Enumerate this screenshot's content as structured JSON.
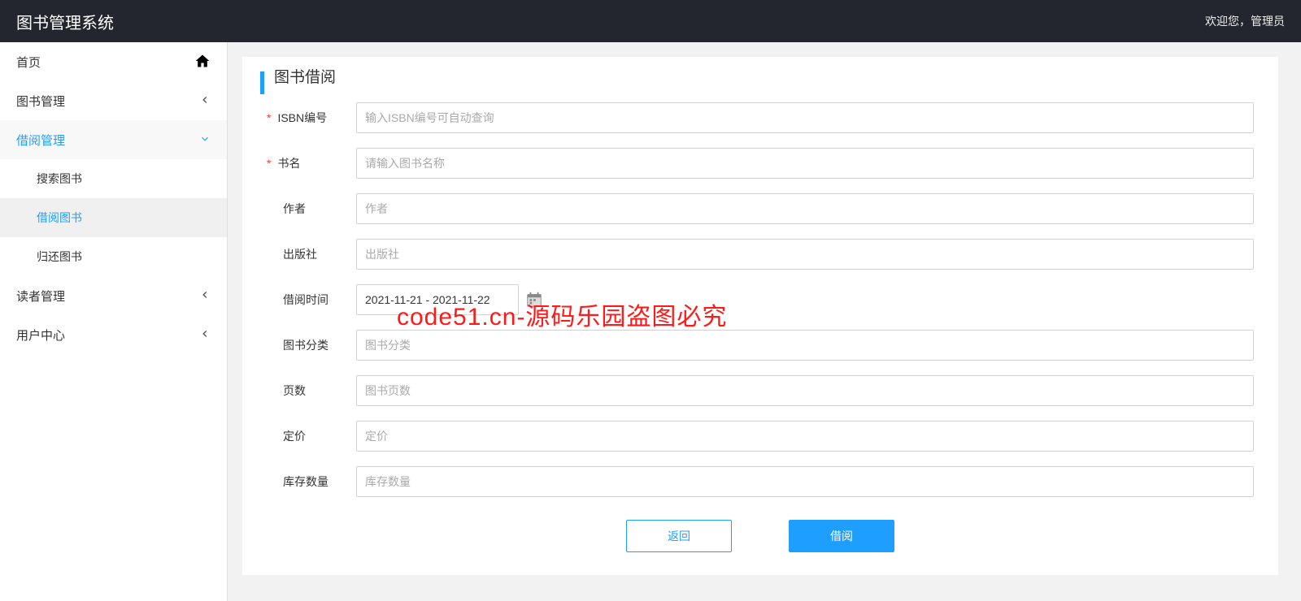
{
  "header": {
    "title": "图书管理系统",
    "welcome": "欢迎您，管理员"
  },
  "sidebar": {
    "items": [
      {
        "label": "首页",
        "icon": "home",
        "kind": "link"
      },
      {
        "label": "图书管理",
        "icon": "chevron-right",
        "kind": "group"
      },
      {
        "label": "借阅管理",
        "icon": "chevron-down",
        "kind": "group",
        "active": true,
        "children": [
          {
            "label": "搜索图书"
          },
          {
            "label": "借阅图书",
            "active": true
          },
          {
            "label": "归还图书"
          }
        ]
      },
      {
        "label": "读者管理",
        "icon": "chevron-right",
        "kind": "group"
      },
      {
        "label": "用户中心",
        "icon": "chevron-right",
        "kind": "group"
      }
    ]
  },
  "page": {
    "title": "图书借阅",
    "fields": {
      "isbn": {
        "label": "ISBN编号",
        "placeholder": "输入ISBN编号可自动查询",
        "required": true
      },
      "bookname": {
        "label": "书名",
        "placeholder": "请输入图书名称",
        "required": true
      },
      "author": {
        "label": "作者",
        "placeholder": "作者"
      },
      "publisher": {
        "label": "出版社",
        "placeholder": "出版社"
      },
      "borrow": {
        "label": "借阅时间",
        "value": "2021-11-21 - 2021-11-22"
      },
      "category": {
        "label": "图书分类",
        "placeholder": "图书分类"
      },
      "pages": {
        "label": "页数",
        "placeholder": "图书页数"
      },
      "price": {
        "label": "定价",
        "placeholder": "定价"
      },
      "stock": {
        "label": "库存数量",
        "placeholder": "库存数量"
      }
    },
    "buttons": {
      "back": "返回",
      "borrow": "借阅"
    }
  },
  "watermark": "code51.cn-源码乐园盗图必究"
}
